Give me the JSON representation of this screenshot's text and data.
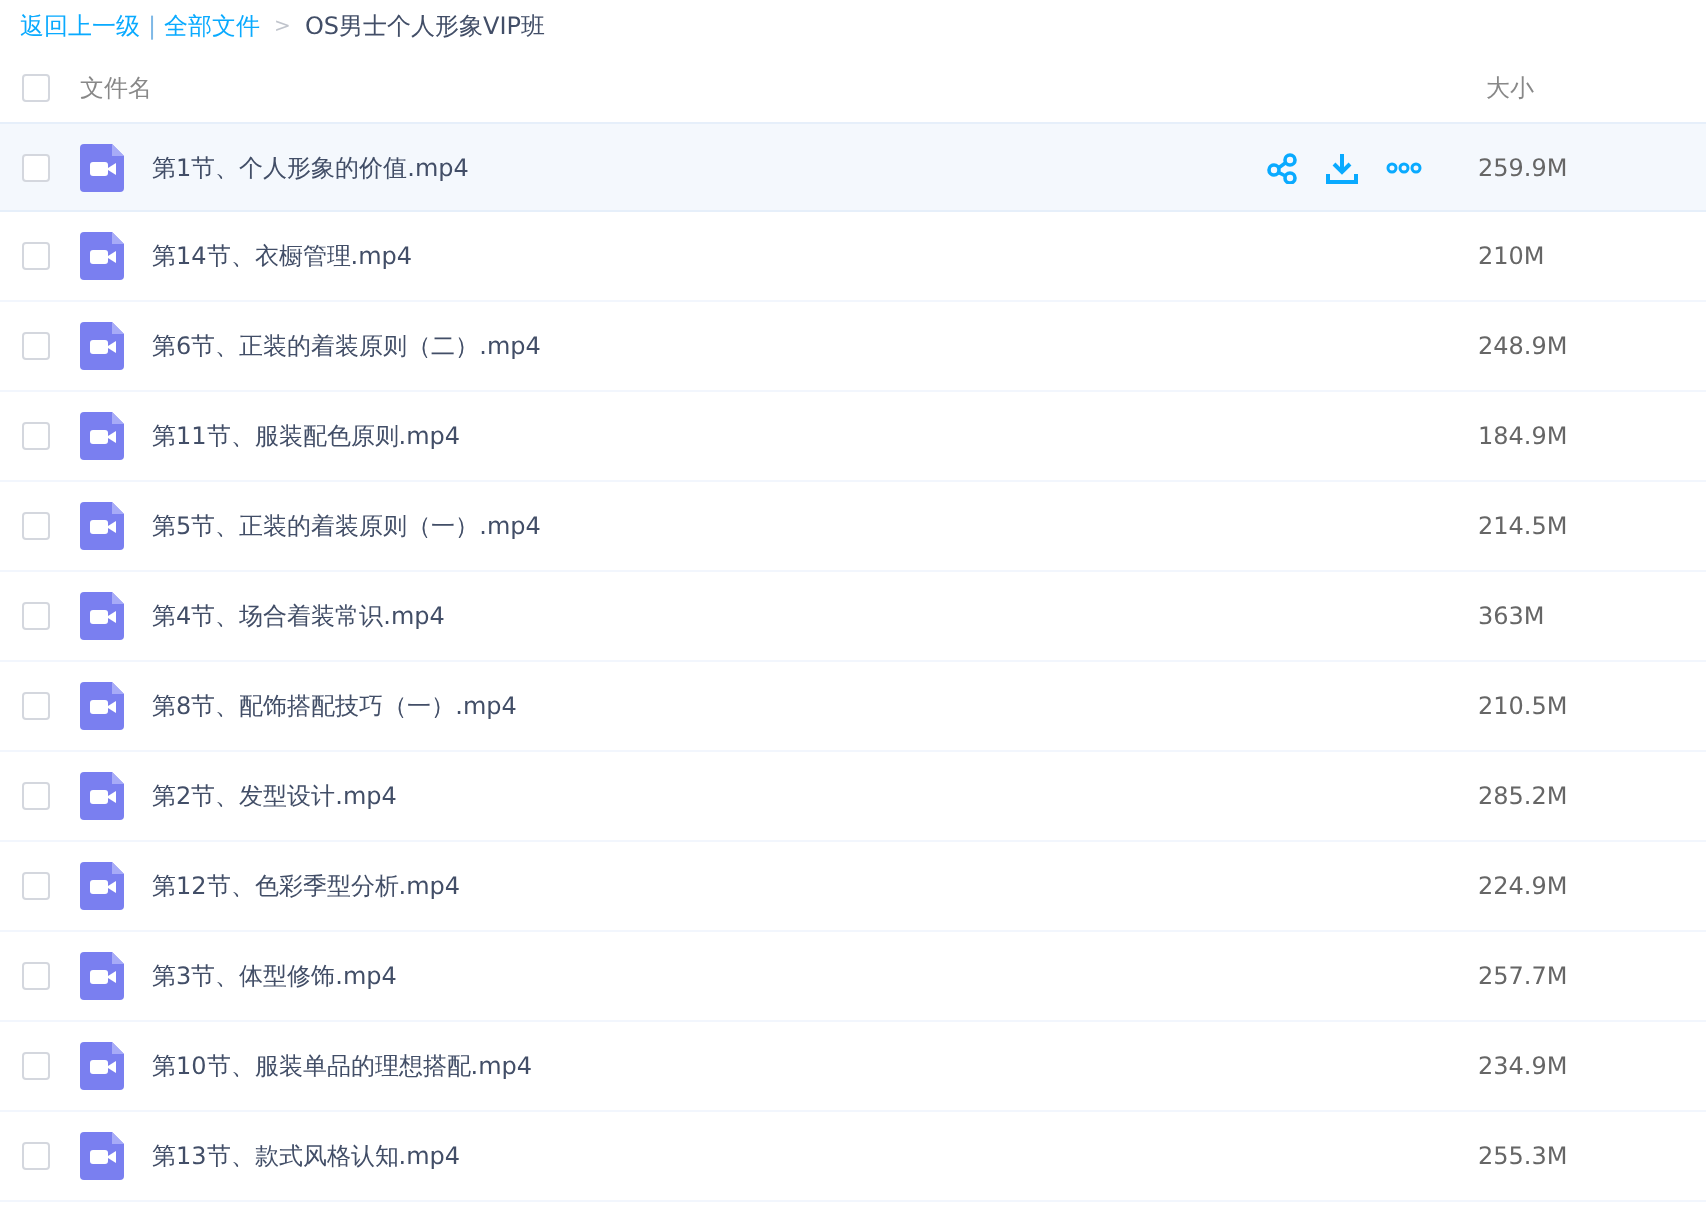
{
  "breadcrumb": {
    "back": "返回上一级",
    "separator": "|",
    "root": "全部文件",
    "arrow": ">",
    "current": "OS男士个人形象VIP班"
  },
  "header": {
    "checked": false,
    "name": "文件名",
    "size": "大小"
  },
  "files": [
    {
      "name": "第1节、个人形象的价值.mp4",
      "size": "259.9M",
      "checked": false,
      "highlighted": true
    },
    {
      "name": "第14节、衣橱管理.mp4",
      "size": "210M",
      "checked": false,
      "highlighted": false
    },
    {
      "name": "第6节、正装的着装原则（二）.mp4",
      "size": "248.9M",
      "checked": false,
      "highlighted": false
    },
    {
      "name": "第11节、服装配色原则.mp4",
      "size": "184.9M",
      "checked": false,
      "highlighted": false
    },
    {
      "name": "第5节、正装的着装原则（一）.mp4",
      "size": "214.5M",
      "checked": false,
      "highlighted": false
    },
    {
      "name": "第4节、场合着装常识.mp4",
      "size": "363M",
      "checked": false,
      "highlighted": false
    },
    {
      "name": "第8节、配饰搭配技巧（一）.mp4",
      "size": "210.5M",
      "checked": false,
      "highlighted": false
    },
    {
      "name": "第2节、发型设计.mp4",
      "size": "285.2M",
      "checked": false,
      "highlighted": false
    },
    {
      "name": "第12节、色彩季型分析.mp4",
      "size": "224.9M",
      "checked": false,
      "highlighted": false
    },
    {
      "name": "第3节、体型修饰.mp4",
      "size": "257.7M",
      "checked": false,
      "highlighted": false
    },
    {
      "name": "第10节、服装单品的理想搭配.mp4",
      "size": "234.9M",
      "checked": false,
      "highlighted": false
    },
    {
      "name": "第13节、款式风格认知.mp4",
      "size": "255.3M",
      "checked": false,
      "highlighted": false
    }
  ]
}
